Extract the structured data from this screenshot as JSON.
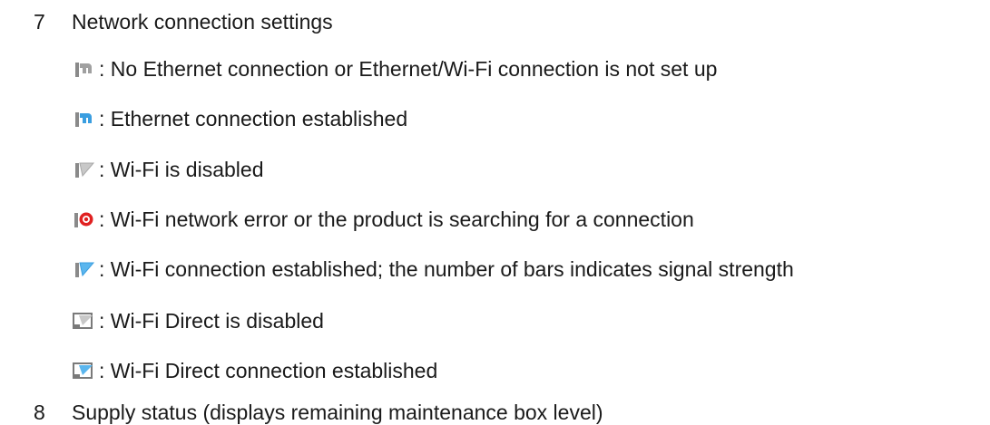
{
  "sections": [
    {
      "number": "7",
      "title": "Network connection settings"
    },
    {
      "number": "8",
      "title": "Supply status (displays remaining maintenance box level)"
    }
  ],
  "items": [
    {
      "icon": "ethernet-disconnected-icon",
      "text": ": No Ethernet connection or Ethernet/Wi-Fi connection is not set up"
    },
    {
      "icon": "ethernet-connected-icon",
      "text": ": Ethernet connection established"
    },
    {
      "icon": "wifi-disabled-icon",
      "text": ": Wi-Fi is disabled"
    },
    {
      "icon": "wifi-error-icon",
      "text": ": Wi-Fi network error or the product is searching for a connection"
    },
    {
      "icon": "wifi-connected-icon",
      "text": ": Wi-Fi connection established; the number of bars indicates signal strength"
    },
    {
      "icon": "wifi-direct-disabled-icon",
      "text": ": Wi-Fi Direct is disabled"
    },
    {
      "icon": "wifi-direct-connected-icon",
      "text": ": Wi-Fi Direct connection established"
    }
  ],
  "colors": {
    "text": "#1a1a1a",
    "icon_gray": "#9a9a9a",
    "icon_blue": "#3a9ee0",
    "icon_red": "#e02020"
  }
}
